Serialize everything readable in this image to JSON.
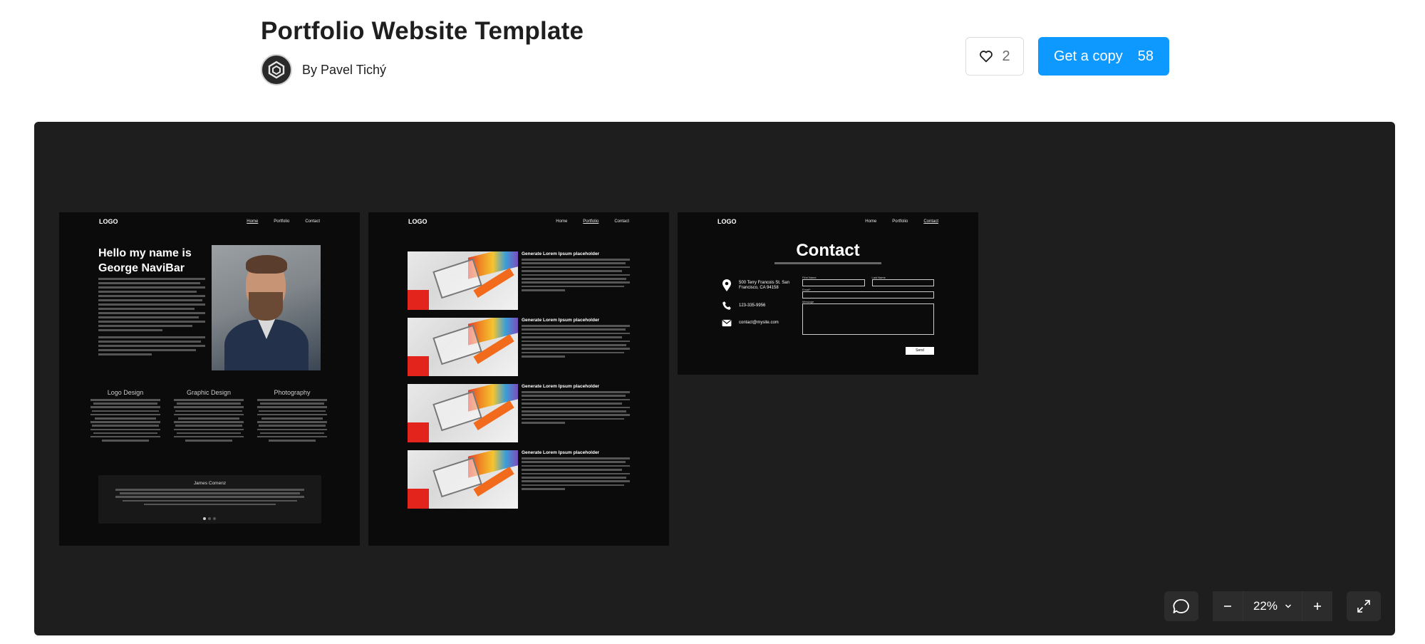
{
  "page": {
    "title": "Portfolio Website Template",
    "author_prefix": "By",
    "author_name": "Pavel Tichý",
    "author_line": "By Pavel Tichý",
    "likes": "2",
    "copy_label": "Get a copy",
    "copy_count": "58"
  },
  "viewer": {
    "zoom": "22%"
  },
  "frames": {
    "home": {
      "logo": "LOGO",
      "nav": [
        "Home",
        "Portfolio",
        "Contact"
      ],
      "hero_title": "Hello my name is George NaviBar",
      "services": [
        {
          "title": "Logo Design"
        },
        {
          "title": "Graphic Design"
        },
        {
          "title": "Photography"
        }
      ],
      "testimonial_name": "James Comenz"
    },
    "portfolio": {
      "logo": "LOGO",
      "nav": [
        "Home",
        "Portfolio",
        "Contact"
      ],
      "posts": [
        {
          "title": "Generate Lorem Ipsum placeholder"
        },
        {
          "title": "Generate Lorem Ipsum placeholder"
        },
        {
          "title": "Generate Lorem Ipsum placeholder"
        },
        {
          "title": "Generate Lorem Ipsum placeholder"
        }
      ]
    },
    "contact": {
      "logo": "LOGO",
      "nav": [
        "Home",
        "Portfolio",
        "Contact"
      ],
      "title": "Contact",
      "address": "500 Terry Francois St. San Francisco, CA 94158",
      "phone": "123-335-9956",
      "email": "contact@mysite.com",
      "form_labels": [
        "First Name",
        "Last Name",
        "Email*",
        "Message"
      ],
      "send_label": "Send"
    }
  }
}
